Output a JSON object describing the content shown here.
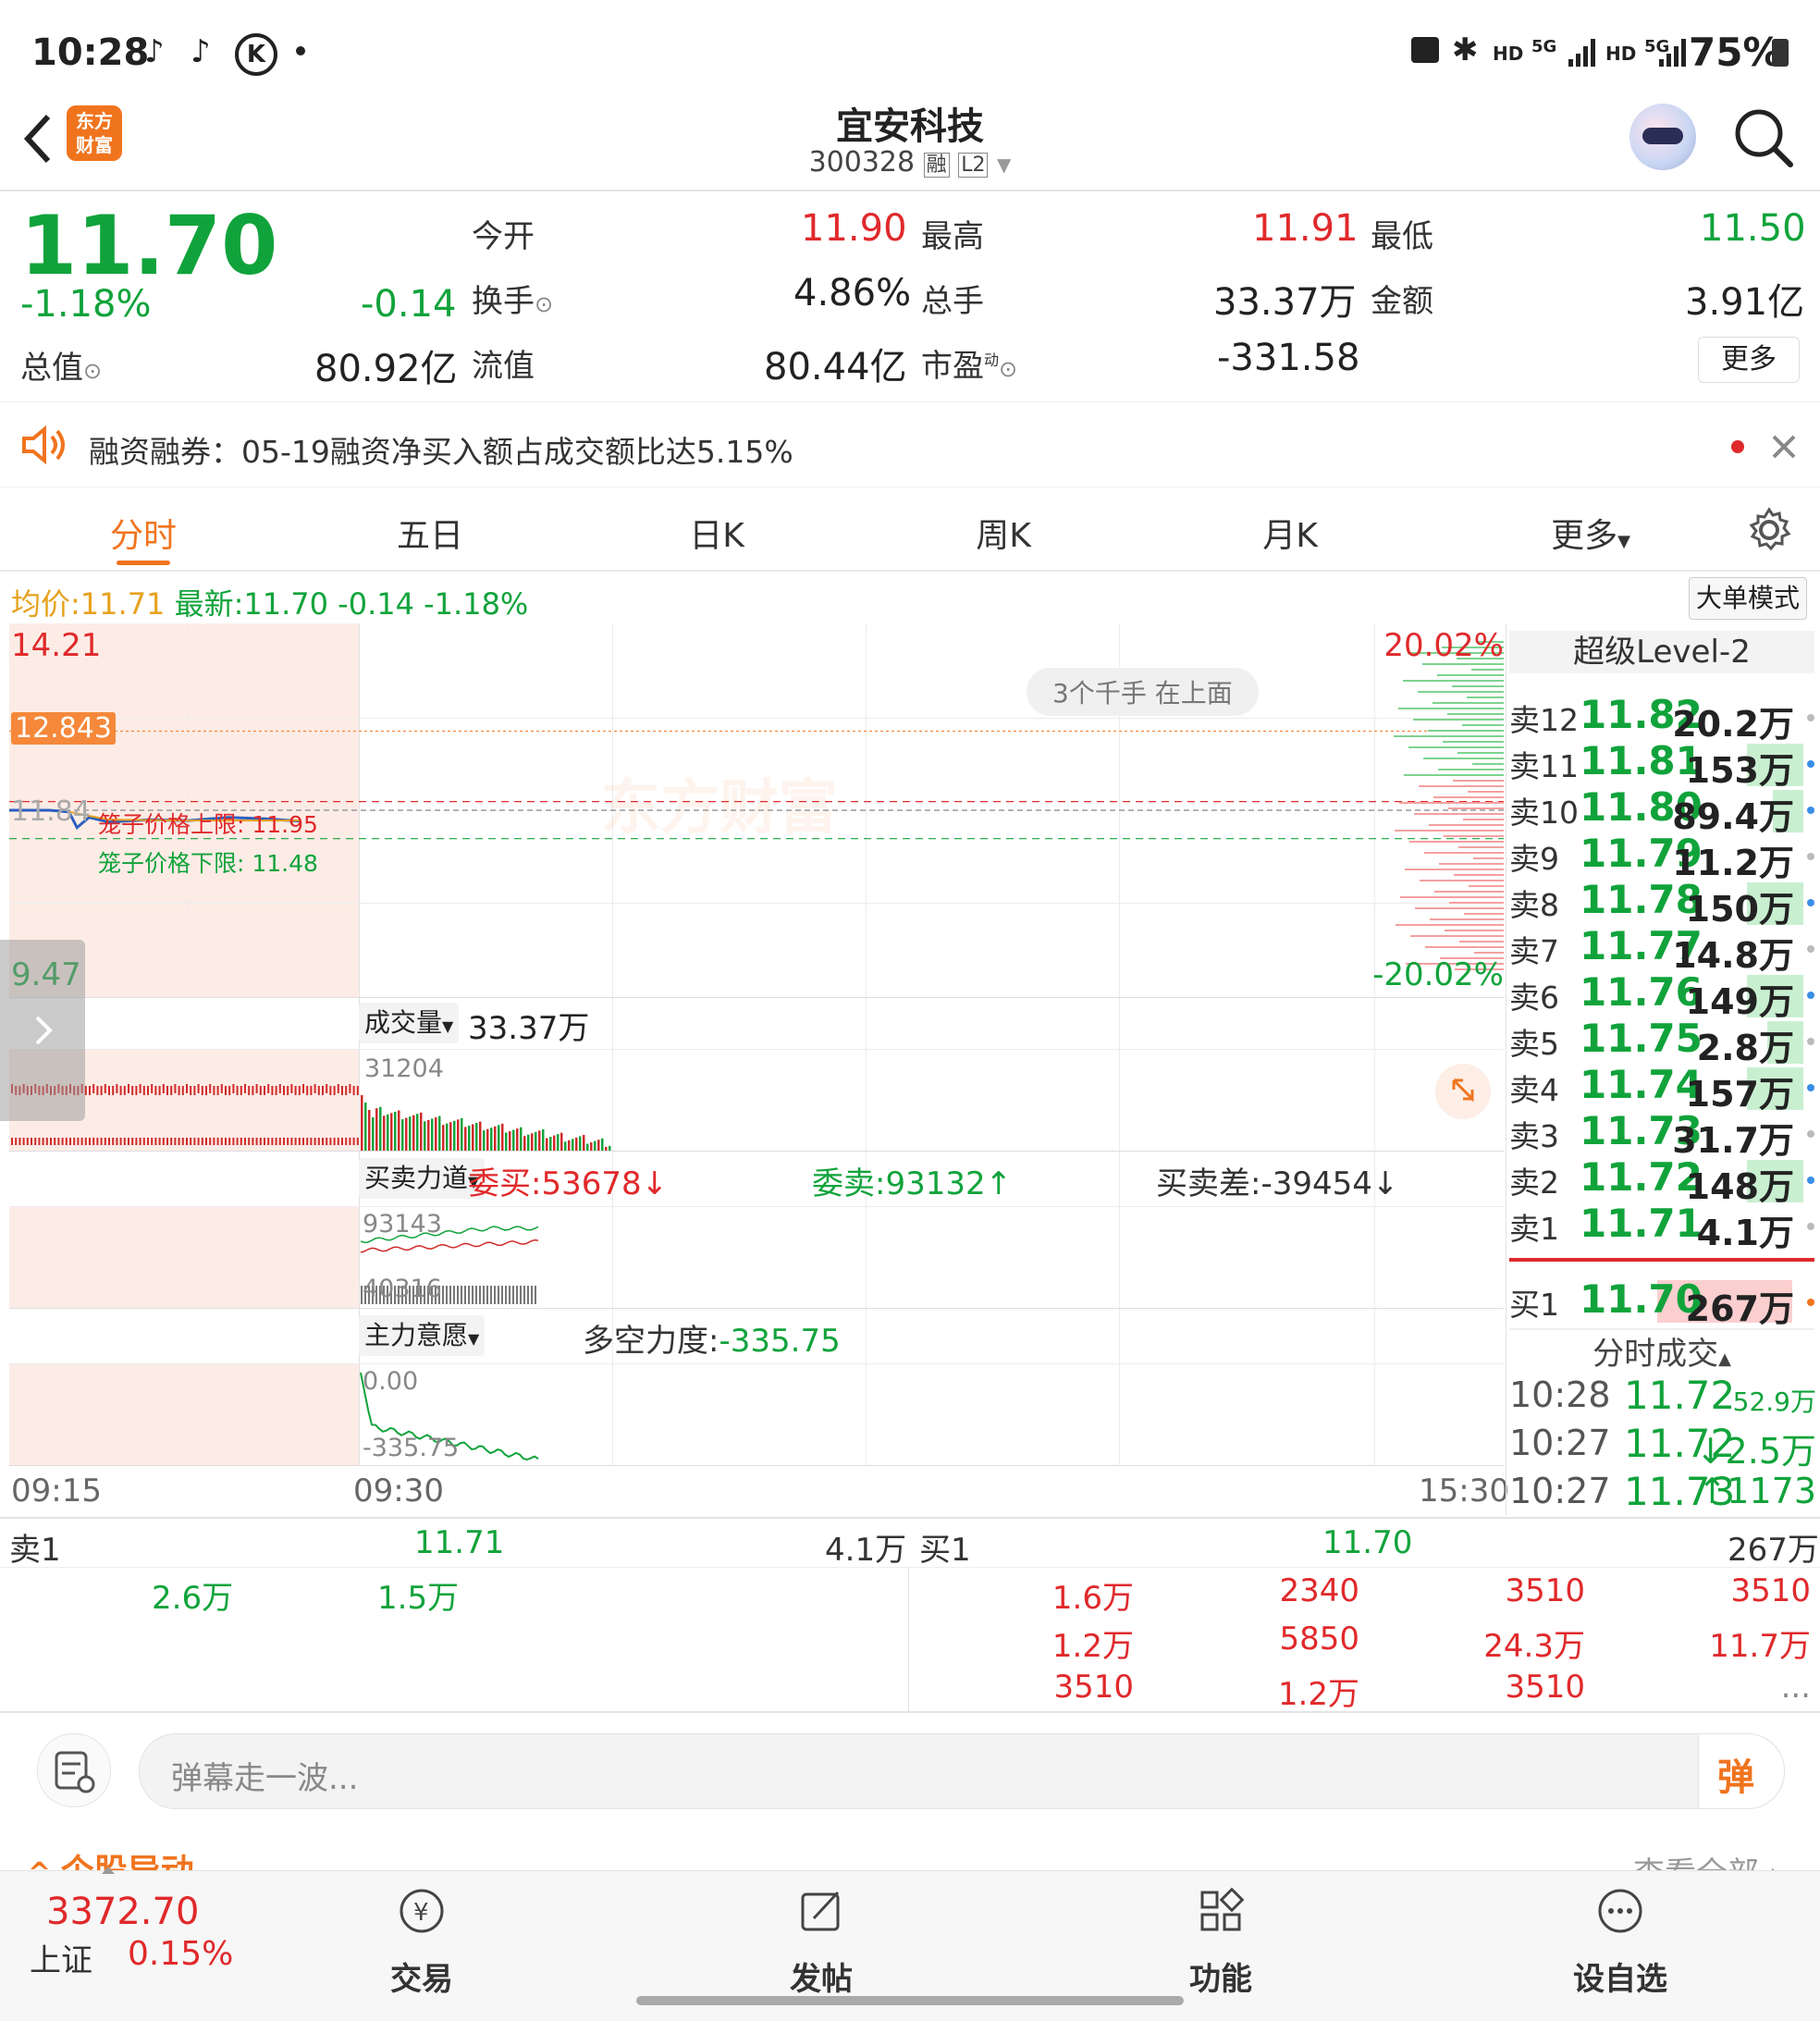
{
  "status_bar": {
    "time": "10:28",
    "battery": "75%",
    "hd1": "HD",
    "hd2": "HD",
    "net1": "5G",
    "net2": "5G"
  },
  "header": {
    "app_logo_line1": "东方",
    "app_logo_line2": "财富",
    "title": "宜安科技",
    "code": "300328",
    "badge1": "融",
    "badge2": "L2"
  },
  "quote": {
    "price": "11.70",
    "change_pct": "-1.18%",
    "change": "-0.14",
    "open_label": "今开",
    "open": "11.90",
    "high_label": "最高",
    "high": "11.91",
    "low_label": "最低",
    "low": "11.50",
    "turnover_label": "换手",
    "turnover": "4.86%",
    "volume_label": "总手",
    "volume": "33.37万",
    "amount_label": "金额",
    "amount": "3.91亿",
    "mcap_label": "总值",
    "mcap": "80.92亿",
    "float_label": "流值",
    "float": "80.44亿",
    "pe_label": "市盈",
    "pe_super": "动",
    "pe": "-331.58",
    "more": "更多"
  },
  "notice": {
    "text": "融资融券：05-19融资净买入额占成交额比达5.15%"
  },
  "tabs": [
    "分时",
    "五日",
    "日K",
    "周K",
    "月K",
    "更多"
  ],
  "chart_info": {
    "avg_label": "均价:",
    "avg": "11.71",
    "last_label": "最新:",
    "last": "11.70",
    "chg": "-0.14",
    "chg_pct": "-1.18%",
    "mode_button": "大单模式"
  },
  "chart": {
    "y_top": "14.21",
    "y_marker": "12.843",
    "y_pre": "11.84",
    "y_bottom": "9.47",
    "pct_top": "20.02%",
    "pct_bottom": "-20.02%",
    "cage_upper": "笼子价格上限: 11.95",
    "cage_lower": "笼子价格下限: 11.48",
    "watermark": "东方财富",
    "pill": "3个千手 在上面",
    "vol_label": "成交量",
    "vol_value": "33.37万",
    "vol_peak": "31204",
    "force_label": "买卖力道",
    "bid_total": "委买:53678↓",
    "ask_total": "委卖:93132↑",
    "diff": "买卖差:-39454↓",
    "force_top": "93143",
    "force_low": "40316",
    "main_label": "主力意愿",
    "power_label": "多空力度:",
    "power_value": "-335.75",
    "main_top": "0.00",
    "main_low": "-335.75",
    "t_start": "09:15",
    "t_open": "09:30",
    "t_end": "15:30"
  },
  "chart_data": {
    "type": "line",
    "xlabel": "",
    "ylabel": "",
    "x_range": [
      "09:15",
      "15:30"
    ],
    "ylim": [
      9.47,
      14.21
    ],
    "pre_close": 11.84,
    "series": [
      {
        "x": [
          "09:15",
          "09:25",
          "09:30",
          "09:32",
          "09:35",
          "09:40",
          "09:50",
          "10:00",
          "10:10",
          "10:20",
          "10:28"
        ],
        "values": [
          11.84,
          11.84,
          11.82,
          11.62,
          11.75,
          11.69,
          11.72,
          11.71,
          11.75,
          11.73,
          11.7
        ]
      },
      {
        "x": [
          "09:30",
          "09:40",
          "10:00",
          "10:28"
        ],
        "values": [
          11.82,
          11.72,
          11.71,
          11.71
        ]
      }
    ]
  },
  "level2": {
    "title": "超级Level-2",
    "asks": [
      {
        "label": "卖12",
        "price": "11.82",
        "vol": "20.2万",
        "bar": 0.0,
        "dot": "#bbbbbb"
      },
      {
        "label": "卖11",
        "price": "11.81",
        "vol": "153万",
        "bar": 0.55,
        "dot": "#3a8ee6"
      },
      {
        "label": "卖10",
        "price": "11.80",
        "vol": "89.4万",
        "bar": 0.3,
        "dot": "#3a8ee6"
      },
      {
        "label": "卖9",
        "price": "11.79",
        "vol": "11.2万",
        "bar": 0.0,
        "dot": "#bbbbbb"
      },
      {
        "label": "卖8",
        "price": "11.78",
        "vol": "150万",
        "bar": 0.55,
        "dot": "#3a8ee6"
      },
      {
        "label": "卖7",
        "price": "11.77",
        "vol": "14.8万",
        "bar": 0.0,
        "dot": "#bbbbbb"
      },
      {
        "label": "卖6",
        "price": "11.76",
        "vol": "149万",
        "bar": 0.55,
        "dot": "#3a8ee6"
      },
      {
        "label": "卖5",
        "price": "11.75",
        "vol": "2.8万",
        "bar": 0.35,
        "dot": "#bbbbbb"
      },
      {
        "label": "卖4",
        "price": "11.74",
        "vol": "157万",
        "bar": 0.55,
        "dot": "#3a8ee6"
      },
      {
        "label": "卖3",
        "price": "11.73",
        "vol": "31.7万",
        "bar": 0.0,
        "dot": "#bbbbbb"
      },
      {
        "label": "卖2",
        "price": "11.72",
        "vol": "148万",
        "bar": 0.55,
        "dot": "#3a8ee6"
      },
      {
        "label": "卖1",
        "price": "11.71",
        "vol": "4.1万",
        "bar": 0.0,
        "dot": "#bbbbbb"
      }
    ],
    "bid1": {
      "label": "买1",
      "price": "11.70",
      "vol": "267万"
    },
    "ticks_title": "分时成交",
    "ticks": [
      {
        "time": "10:28",
        "price": "11.72",
        "vol": "52.9万"
      },
      {
        "time": "10:27",
        "price": "11.72",
        "vol": "↓2.5万"
      },
      {
        "time": "10:27",
        "price": "11.73",
        "vol": "↑1173"
      }
    ]
  },
  "depth": {
    "ask_label": "卖1",
    "ask_price": "11.71",
    "ask_vol": "4.1万",
    "bid_label": "买1",
    "bid_price": "11.70",
    "bid_vol": "267万",
    "ask_orders": [
      "2.6万",
      "1.5万"
    ],
    "bid_orders": [
      "1.6万",
      "2340",
      "3510",
      "3510",
      "1.2万",
      "5850",
      "24.3万",
      "11.7万",
      "3510",
      "1.2万",
      "3510",
      "..."
    ]
  },
  "comment": {
    "placeholder": "弹幕走一波...",
    "send": "弹"
  },
  "section_peek": {
    "left": "个股异动",
    "right": "查看全部"
  },
  "bottom_nav": {
    "index_value": "3372.70",
    "index_name": "上证",
    "index_pct": "0.15%",
    "items": [
      "交易",
      "发帖",
      "功能",
      "设自选"
    ]
  }
}
